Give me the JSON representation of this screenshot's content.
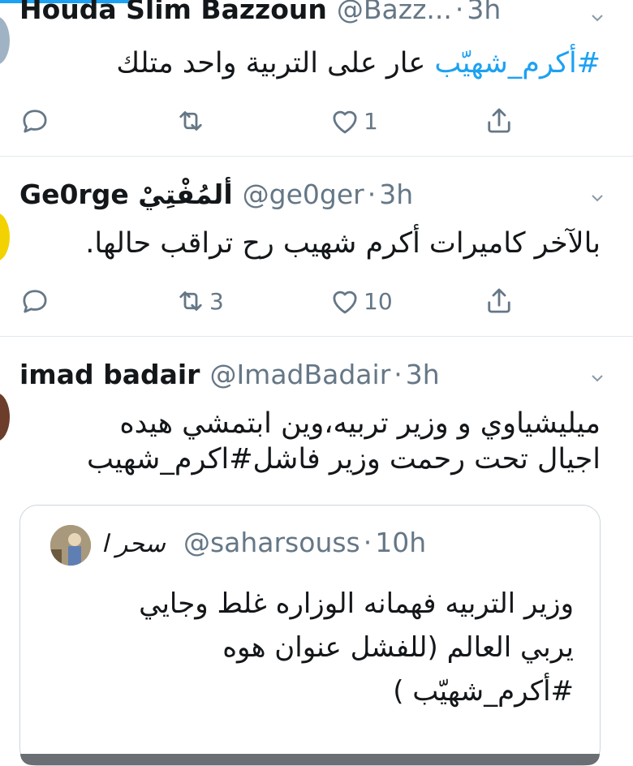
{
  "tweets": [
    {
      "name": "Houda Slim Bazzoun",
      "handle": "@Bazz...",
      "dot": "·",
      "time": "3h",
      "body_hashtag": "#أكرم_شهيّب",
      "body_text": " عار على التربية واحد متلك",
      "replies": "",
      "retweets": "",
      "likes": "1"
    },
    {
      "name": "Ge0rge ألمُفْتِيْ",
      "handle": "@ge0ger",
      "dot": "·",
      "time": "3h",
      "body_text": "بالآخر كاميرات أكرم شهيب رح تراقب حالها.",
      "replies": "",
      "retweets": "3",
      "likes": "10"
    },
    {
      "name": "imad badair",
      "handle": "@ImadBadair",
      "dot": "·",
      "time": "3h",
      "body_line1": "ميليشياوي و وزير تربيه،وين ابتمشي هيده",
      "body_line2": "اجيال تحت رحمت  وزير فاشل#اكرم_شهيب"
    }
  ],
  "quote": {
    "name": "سحر ا",
    "handle": "@saharsouss",
    "dot": "·",
    "time": "10h",
    "line1": "وزير التربيه فهمانه الوزاره غلط وجايي",
    "line2": "يربي العالم (للفشل عنوان هوه",
    "line3": "#أكرم_شهيّب )"
  },
  "icons": {
    "reply": "reply-icon",
    "retweet": "retweet-icon",
    "like": "heart-icon",
    "share": "share-icon",
    "caret": "chevron-down-icon"
  },
  "colors": {
    "accent": "#1da1f2",
    "muted": "#657786",
    "divider": "#e1e8ed"
  }
}
